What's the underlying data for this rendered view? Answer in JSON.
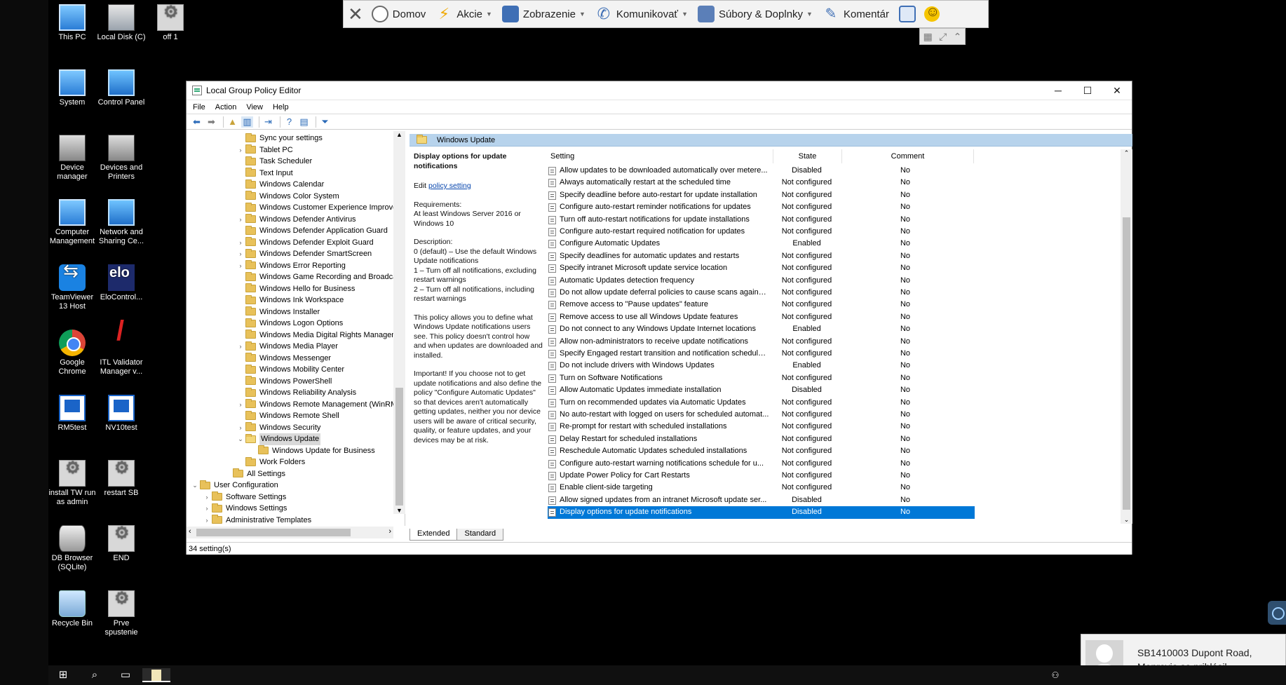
{
  "desktop": {
    "icons": [
      {
        "label": "This PC"
      },
      {
        "label": "Local Disk (C)"
      },
      {
        "label": "off 1"
      },
      {
        "label": "System"
      },
      {
        "label": "Control Panel"
      },
      {
        "label": "Device manager"
      },
      {
        "label": "Devices and Printers"
      },
      {
        "label": "Computer Management"
      },
      {
        "label": "Network and Sharing Ce..."
      },
      {
        "label": "TeamViewer 13 Host"
      },
      {
        "label": "EloControl..."
      },
      {
        "label": "Google Chrome"
      },
      {
        "label": "ITL Validator Manager v..."
      },
      {
        "label": "RM5test"
      },
      {
        "label": "NV10test"
      },
      {
        "label": "install TW run as admin"
      },
      {
        "label": "restart SB"
      },
      {
        "label": "DB Browser (SQLite)"
      },
      {
        "label": "END"
      },
      {
        "label": "Recycle Bin"
      },
      {
        "label": "Prve spustenie"
      }
    ]
  },
  "remote_toolbar": {
    "home": "Domov",
    "actions": "Akcie",
    "view": "Zobrazenie",
    "communicate": "Komunikovať",
    "files": "Súbory & Doplnky",
    "comment": "Komentár"
  },
  "window": {
    "title": "Local Group Policy Editor",
    "menu": [
      "File",
      "Action",
      "View",
      "Help"
    ],
    "status": "34 setting(s)",
    "tabs": [
      "Extended",
      "Standard"
    ]
  },
  "tree": {
    "items": [
      {
        "label": "Sync your settings",
        "expander": ""
      },
      {
        "label": "Tablet PC",
        "expander": "›"
      },
      {
        "label": "Task Scheduler",
        "expander": ""
      },
      {
        "label": "Text Input",
        "expander": ""
      },
      {
        "label": "Windows Calendar",
        "expander": ""
      },
      {
        "label": "Windows Color System",
        "expander": ""
      },
      {
        "label": "Windows Customer Experience Improvem",
        "expander": ""
      },
      {
        "label": "Windows Defender Antivirus",
        "expander": "›"
      },
      {
        "label": "Windows Defender Application Guard",
        "expander": ""
      },
      {
        "label": "Windows Defender Exploit Guard",
        "expander": "›"
      },
      {
        "label": "Windows Defender SmartScreen",
        "expander": "›"
      },
      {
        "label": "Windows Error Reporting",
        "expander": "›"
      },
      {
        "label": "Windows Game Recording and Broadcasti",
        "expander": ""
      },
      {
        "label": "Windows Hello for Business",
        "expander": ""
      },
      {
        "label": "Windows Ink Workspace",
        "expander": ""
      },
      {
        "label": "Windows Installer",
        "expander": ""
      },
      {
        "label": "Windows Logon Options",
        "expander": ""
      },
      {
        "label": "Windows Media Digital Rights Manageme",
        "expander": ""
      },
      {
        "label": "Windows Media Player",
        "expander": "›"
      },
      {
        "label": "Windows Messenger",
        "expander": ""
      },
      {
        "label": "Windows Mobility Center",
        "expander": ""
      },
      {
        "label": "Windows PowerShell",
        "expander": ""
      },
      {
        "label": "Windows Reliability Analysis",
        "expander": ""
      },
      {
        "label": "Windows Remote Management (WinRM)",
        "expander": "›"
      },
      {
        "label": "Windows Remote Shell",
        "expander": ""
      },
      {
        "label": "Windows Security",
        "expander": "›"
      },
      {
        "label": "Windows Update",
        "expander": "⌄"
      },
      {
        "label": "Windows Update for Business",
        "expander": ""
      },
      {
        "label": "Work Folders",
        "expander": ""
      },
      {
        "label": "All Settings",
        "expander": ""
      },
      {
        "label": "User Configuration",
        "expander": "⌄"
      },
      {
        "label": "Software Settings",
        "expander": "›"
      },
      {
        "label": "Windows Settings",
        "expander": "›"
      },
      {
        "label": "Administrative Templates",
        "expander": "›"
      }
    ]
  },
  "right": {
    "folder_title": "Windows Update",
    "description": {
      "title": "Display options for update notifications",
      "edit_prefix": "Edit ",
      "edit_link": "policy setting",
      "requirements": "Requirements:\nAt least Windows Server 2016 or Windows 10",
      "description": "Description:\n0 (default) – Use the default Windows Update notifications\n1 – Turn off all notifications, excluding restart warnings\n2 – Turn off all notifications, including restart warnings",
      "para1": "This policy allows you to define what Windows Update notifications users see. This policy doesn't control how and when updates are downloaded and installed.",
      "para2": "Important! If you choose not to get update notifications and also define the policy \"Configure Automatic Updates\" so that devices aren't automatically getting updates, neither you nor device users will be aware of critical security, quality, or feature updates, and your devices may be at risk."
    },
    "columns": {
      "setting": "Setting",
      "state": "State",
      "comment": "Comment"
    },
    "rows": [
      {
        "setting": "Allow updates to be downloaded automatically over metere...",
        "state": "Disabled",
        "comment": "No"
      },
      {
        "setting": "Always automatically restart at the scheduled time",
        "state": "Not configured",
        "comment": "No"
      },
      {
        "setting": "Specify deadline before auto-restart for update installation",
        "state": "Not configured",
        "comment": "No"
      },
      {
        "setting": "Configure auto-restart reminder notifications for updates",
        "state": "Not configured",
        "comment": "No"
      },
      {
        "setting": "Turn off auto-restart notifications for update installations",
        "state": "Not configured",
        "comment": "No"
      },
      {
        "setting": "Configure auto-restart required notification for updates",
        "state": "Not configured",
        "comment": "No"
      },
      {
        "setting": "Configure Automatic Updates",
        "state": "Enabled",
        "comment": "No"
      },
      {
        "setting": "Specify deadlines for automatic updates and restarts",
        "state": "Not configured",
        "comment": "No"
      },
      {
        "setting": "Specify intranet Microsoft update service location",
        "state": "Not configured",
        "comment": "No"
      },
      {
        "setting": "Automatic Updates detection frequency",
        "state": "Not configured",
        "comment": "No"
      },
      {
        "setting": "Do not allow update deferral policies to cause scans against ...",
        "state": "Not configured",
        "comment": "No"
      },
      {
        "setting": "Remove access to \"Pause updates\" feature",
        "state": "Not configured",
        "comment": "No"
      },
      {
        "setting": "Remove access to use all Windows Update features",
        "state": "Not configured",
        "comment": "No"
      },
      {
        "setting": "Do not connect to any Windows Update Internet locations",
        "state": "Enabled",
        "comment": "No"
      },
      {
        "setting": "Allow non-administrators to receive update notifications",
        "state": "Not configured",
        "comment": "No"
      },
      {
        "setting": "Specify Engaged restart transition and notification schedule ...",
        "state": "Not configured",
        "comment": "No"
      },
      {
        "setting": "Do not include drivers with Windows Updates",
        "state": "Enabled",
        "comment": "No"
      },
      {
        "setting": "Turn on Software Notifications",
        "state": "Not configured",
        "comment": "No"
      },
      {
        "setting": "Allow Automatic Updates immediate installation",
        "state": "Disabled",
        "comment": "No"
      },
      {
        "setting": "Turn on recommended updates via Automatic Updates",
        "state": "Not configured",
        "comment": "No"
      },
      {
        "setting": "No auto-restart with logged on users for scheduled automat...",
        "state": "Not configured",
        "comment": "No"
      },
      {
        "setting": "Re-prompt for restart with scheduled installations",
        "state": "Not configured",
        "comment": "No"
      },
      {
        "setting": "Delay Restart for scheduled installations",
        "state": "Not configured",
        "comment": "No"
      },
      {
        "setting": "Reschedule Automatic Updates scheduled installations",
        "state": "Not configured",
        "comment": "No"
      },
      {
        "setting": "Configure auto-restart warning notifications schedule for u...",
        "state": "Not configured",
        "comment": "No"
      },
      {
        "setting": "Update Power Policy for Cart Restarts",
        "state": "Not configured",
        "comment": "No"
      },
      {
        "setting": "Enable client-side targeting",
        "state": "Not configured",
        "comment": "No"
      },
      {
        "setting": "Allow signed updates from an intranet Microsoft update ser...",
        "state": "Disabled",
        "comment": "No"
      },
      {
        "setting": "Display options for update notifications",
        "state": "Disabled",
        "comment": "No"
      }
    ],
    "selected_index": 28
  },
  "toast": {
    "line1": "SB1410003 Dupont Road,",
    "line2": "Monrovia sa prihlásil"
  },
  "colors": {
    "selection": "#0078d7",
    "folder_header": "#b7d3ec"
  }
}
